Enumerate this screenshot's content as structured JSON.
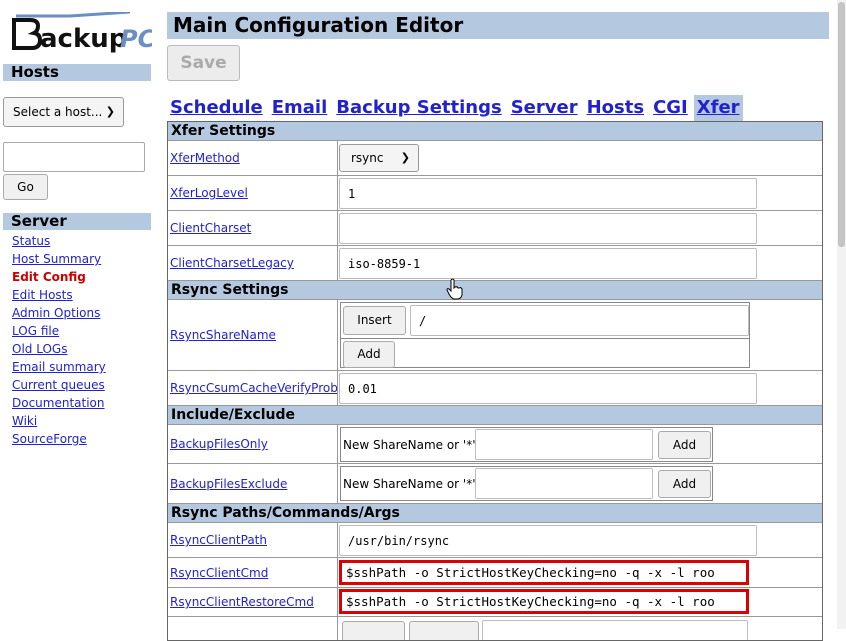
{
  "logo": {
    "text_main": "ackup",
    "text_pc": "PC"
  },
  "nav": {
    "hosts_heading": "Hosts",
    "host_select_value": "Select a host...",
    "go_label": "Go",
    "server_heading": "Server",
    "links": [
      "Status",
      "Host Summary",
      "Edit Config",
      "Edit Hosts",
      "Admin Options",
      "LOG file",
      "Old LOGs",
      "Email summary",
      "Current queues",
      "Documentation",
      "Wiki",
      "SourceForge"
    ]
  },
  "main": {
    "title": "Main Configuration Editor",
    "save_label": "Save",
    "tabs": [
      "Schedule",
      "Email",
      "Backup Settings",
      "Server",
      "Hosts",
      "CGI",
      "Xfer"
    ]
  },
  "sections": {
    "xfer": "Xfer Settings",
    "rsync": "Rsync Settings",
    "include": "Include/Exclude",
    "paths": "Rsync Paths/Commands/Args"
  },
  "rows": {
    "xfer_method": {
      "label": "XferMethod",
      "value": "rsync"
    },
    "xfer_log_level": {
      "label": "XferLogLevel",
      "value": "1"
    },
    "client_charset": {
      "label": "ClientCharset",
      "value": ""
    },
    "client_charset_legacy": {
      "label": "ClientCharsetLegacy",
      "value": "iso-8859-1"
    },
    "rsync_share_name": {
      "label": "RsyncShareName",
      "insert_label": "Insert",
      "value": "/",
      "add_label": "Add"
    },
    "rsync_csum": {
      "label": "RsyncCsumCacheVerifyProb",
      "value": "0.01"
    },
    "backup_files_only": {
      "label": "BackupFilesOnly",
      "prompt": "New ShareName or '*':",
      "add_label": "Add"
    },
    "backup_files_exclude": {
      "label": "BackupFilesExclude",
      "prompt": "New ShareName or '*':",
      "add_label": "Add"
    },
    "rsync_client_path": {
      "label": "RsyncClientPath",
      "value": "/usr/bin/rsync"
    },
    "rsync_client_cmd": {
      "label": "RsyncClientCmd",
      "value": "$sshPath  -o StrictHostKeyChecking=no -q -x -l roo"
    },
    "rsync_client_restore_cmd": {
      "label": "RsyncClientRestoreCmd",
      "value": "$sshPath  -o StrictHostKeyChecking=no -q -x -l roo"
    }
  },
  "colors": {
    "header_bg": "#b4c8e0",
    "link": "#2222cc",
    "active_link": "#cc0000",
    "highlight_border": "#dd0000"
  }
}
